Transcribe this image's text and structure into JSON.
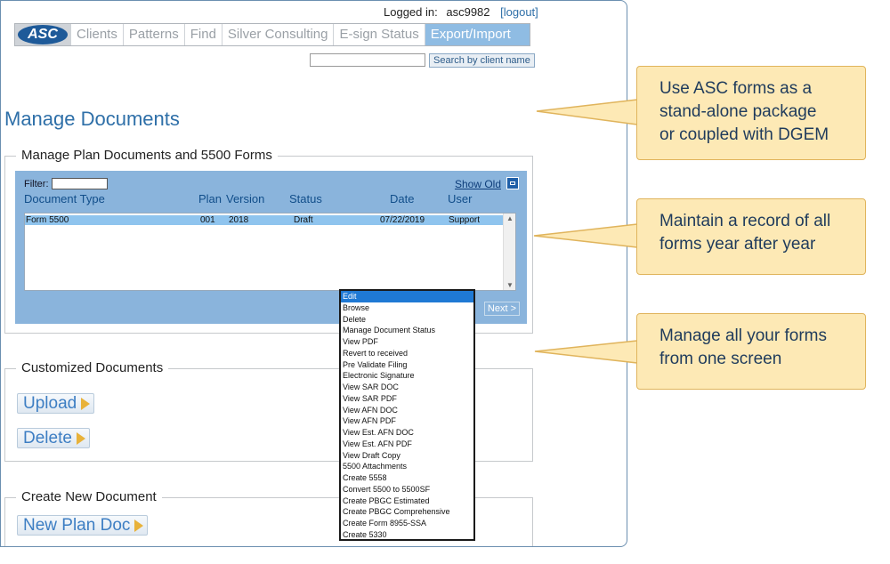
{
  "header": {
    "logged_in_label": "Logged in:",
    "username": "asc9982",
    "logout": "[logout]"
  },
  "nav": {
    "logo": "ASC",
    "tabs": [
      "Clients",
      "Patterns",
      "Find",
      "Silver Consulting",
      "E-sign Status",
      "Export/Import"
    ],
    "active_tab": "Export/Import"
  },
  "search": {
    "value": "",
    "button": "Search by client name"
  },
  "page_title": "Manage Documents",
  "plan_docs": {
    "legend": "Manage Plan Documents and 5500 Forms",
    "filter_label": "Filter:",
    "show_old": "Show Old",
    "columns": [
      "Document Type",
      "Plan",
      "Version",
      "Status",
      "Date",
      "User"
    ],
    "rows": [
      {
        "type": "Form 5500",
        "plan": "001",
        "version": "2018",
        "status": "Draft",
        "date": "07/22/2019",
        "user": "Support"
      }
    ],
    "next": "Next >"
  },
  "custom_docs": {
    "legend": "Customized Documents",
    "upload": "Upload",
    "delete": "Delete"
  },
  "new_doc": {
    "legend": "Create New Document",
    "new_plan_doc": "New Plan Doc"
  },
  "context_menu": {
    "items": [
      "Edit",
      "Browse",
      "Delete",
      "Manage Document Status",
      "View PDF",
      "Revert to received",
      "Pre Validate Filing",
      "Electronic Signature",
      "View SAR DOC",
      "View SAR PDF",
      "View AFN DOC",
      "View AFN PDF",
      "View Est. AFN DOC",
      "View Est. AFN PDF",
      "View Draft Copy",
      "5500 Attachments",
      "Create 5558",
      "Convert 5500 to 5500SF",
      "Create PBGC Estimated",
      "Create PBGC Comprehensive",
      "Create Form 8955-SSA",
      "Create 5330"
    ],
    "selected": "Edit"
  },
  "callouts": [
    [
      "Use ASC forms as a",
      "stand-alone package",
      "or coupled with DGEM"
    ],
    [
      "Maintain a record of all",
      "forms year after year"
    ],
    [
      "Manage all your forms",
      "from one screen"
    ]
  ],
  "colors": {
    "accent": "#2e6fa8",
    "panel": "#8ab4dc",
    "callout_bg": "#fde9b5",
    "callout_border": "#e0b45c"
  }
}
